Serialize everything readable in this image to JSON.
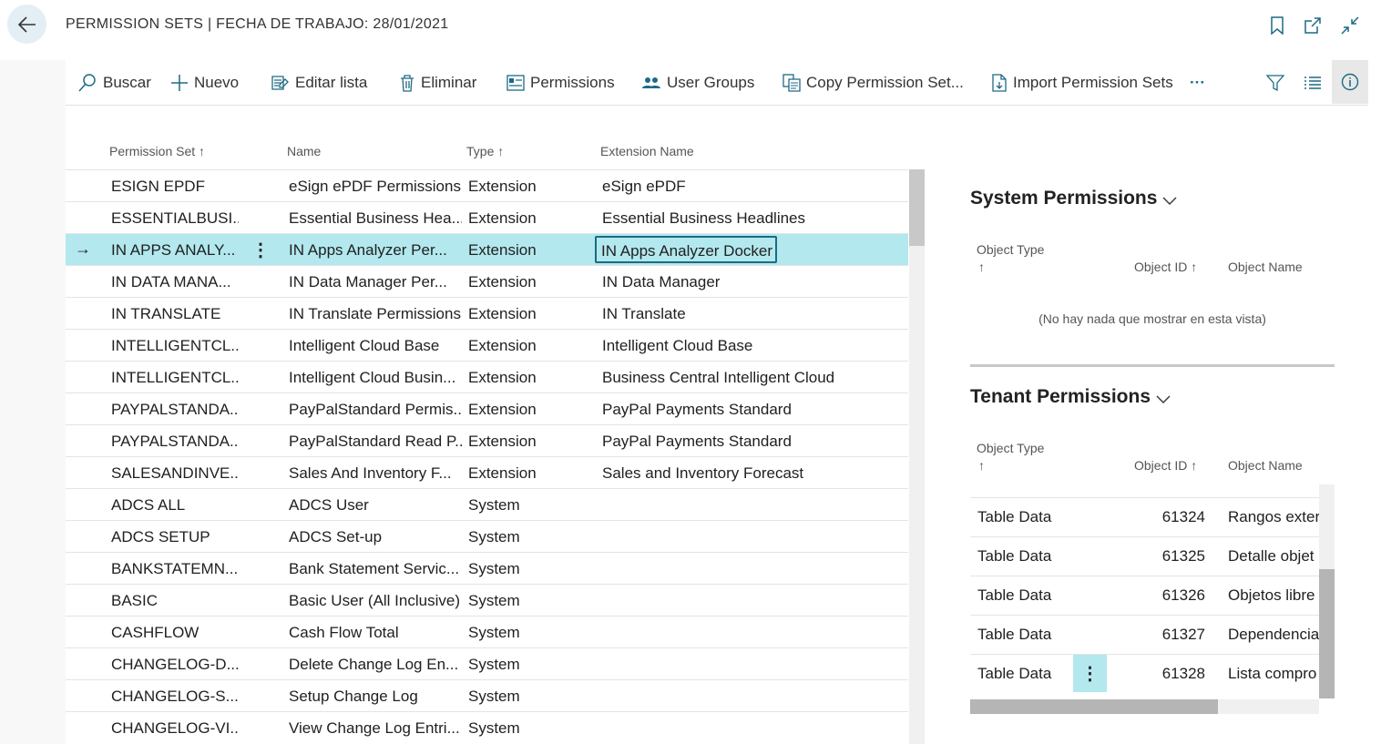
{
  "header": {
    "title": "PERMISSION SETS | FECHA DE TRABAJO: 28/01/2021"
  },
  "actions": {
    "search": "Buscar",
    "new": "Nuevo",
    "edit_list": "Editar lista",
    "delete": "Eliminar",
    "permissions": "Permissions",
    "user_groups": "User Groups",
    "copy_permission_set": "Copy Permission Set...",
    "import_permission_sets": "Import Permission Sets",
    "more": "···"
  },
  "list": {
    "columns": {
      "permission_set": "Permission Set",
      "name": "Name",
      "type": "Type",
      "extension_name": "Extension Name"
    },
    "sort_arrow": "↑",
    "row_menu": "⋮",
    "selected_arrow": "→",
    "rows": [
      {
        "set": "ESIGN EPDF",
        "name": "eSign ePDF Permissions",
        "type": "Extension",
        "ext": "eSign ePDF"
      },
      {
        "set": "ESSENTIALBUSI...",
        "name": "Essential Business Hea...",
        "type": "Extension",
        "ext": "Essential Business Headlines"
      },
      {
        "set": "IN APPS ANALY...",
        "name": "IN Apps Analyzer Per...",
        "type": "Extension",
        "ext": "IN Apps Analyzer Docker"
      },
      {
        "set": "IN DATA MANA...",
        "name": "IN Data Manager Per...",
        "type": "Extension",
        "ext": "IN Data Manager"
      },
      {
        "set": "IN TRANSLATE",
        "name": "IN Translate Permissions",
        "type": "Extension",
        "ext": "IN Translate"
      },
      {
        "set": "INTELLIGENTCL...",
        "name": "Intelligent Cloud Base",
        "type": "Extension",
        "ext": "Intelligent Cloud Base"
      },
      {
        "set": "INTELLIGENTCL...",
        "name": "Intelligent Cloud Busin...",
        "type": "Extension",
        "ext": "Business Central Intelligent Cloud"
      },
      {
        "set": "PAYPALSTANDA...",
        "name": "PayPalStandard Permis...",
        "type": "Extension",
        "ext": "PayPal Payments Standard"
      },
      {
        "set": "PAYPALSTANDA...",
        "name": "PayPalStandard Read P...",
        "type": "Extension",
        "ext": "PayPal Payments Standard"
      },
      {
        "set": "SALESANDINVE...",
        "name": "Sales And Inventory F...",
        "type": "Extension",
        "ext": "Sales and Inventory Forecast"
      },
      {
        "set": "ADCS ALL",
        "name": "ADCS User",
        "type": "System",
        "ext": ""
      },
      {
        "set": "ADCS SETUP",
        "name": "ADCS Set-up",
        "type": "System",
        "ext": ""
      },
      {
        "set": "BANKSTATEMN...",
        "name": "Bank Statement Servic...",
        "type": "System",
        "ext": ""
      },
      {
        "set": "BASIC",
        "name": "Basic User (All Inclusive)",
        "type": "System",
        "ext": ""
      },
      {
        "set": "CASHFLOW",
        "name": "Cash Flow Total",
        "type": "System",
        "ext": ""
      },
      {
        "set": "CHANGELOG-D...",
        "name": "Delete Change Log En...",
        "type": "System",
        "ext": ""
      },
      {
        "set": "CHANGELOG-S...",
        "name": "Setup Change Log",
        "type": "System",
        "ext": ""
      },
      {
        "set": "CHANGELOG-VI...",
        "name": "View Change Log Entri...",
        "type": "System",
        "ext": ""
      }
    ]
  },
  "system_permissions": {
    "title": "System Permissions",
    "col_object_type": "Object Type",
    "col_object_id": "Object ID",
    "col_object_name": "Object Name",
    "empty": "(No hay nada que mostrar en esta vista)"
  },
  "tenant_permissions": {
    "title": "Tenant Permissions",
    "col_object_type": "Object Type",
    "col_object_id": "Object ID",
    "col_object_name": "Object Name",
    "rows": [
      {
        "type": "Table Data",
        "id": "61324",
        "name": "Rangos exter"
      },
      {
        "type": "Table Data",
        "id": "61325",
        "name": "Detalle objet"
      },
      {
        "type": "Table Data",
        "id": "61326",
        "name": "Objetos libre"
      },
      {
        "type": "Table Data",
        "id": "61327",
        "name": "Dependencia"
      },
      {
        "type": "Table Data",
        "id": "61328",
        "name": "Lista compro"
      }
    ]
  },
  "colors": {
    "selected_row": "#b2e8ee",
    "accent": "#1d6a84"
  }
}
